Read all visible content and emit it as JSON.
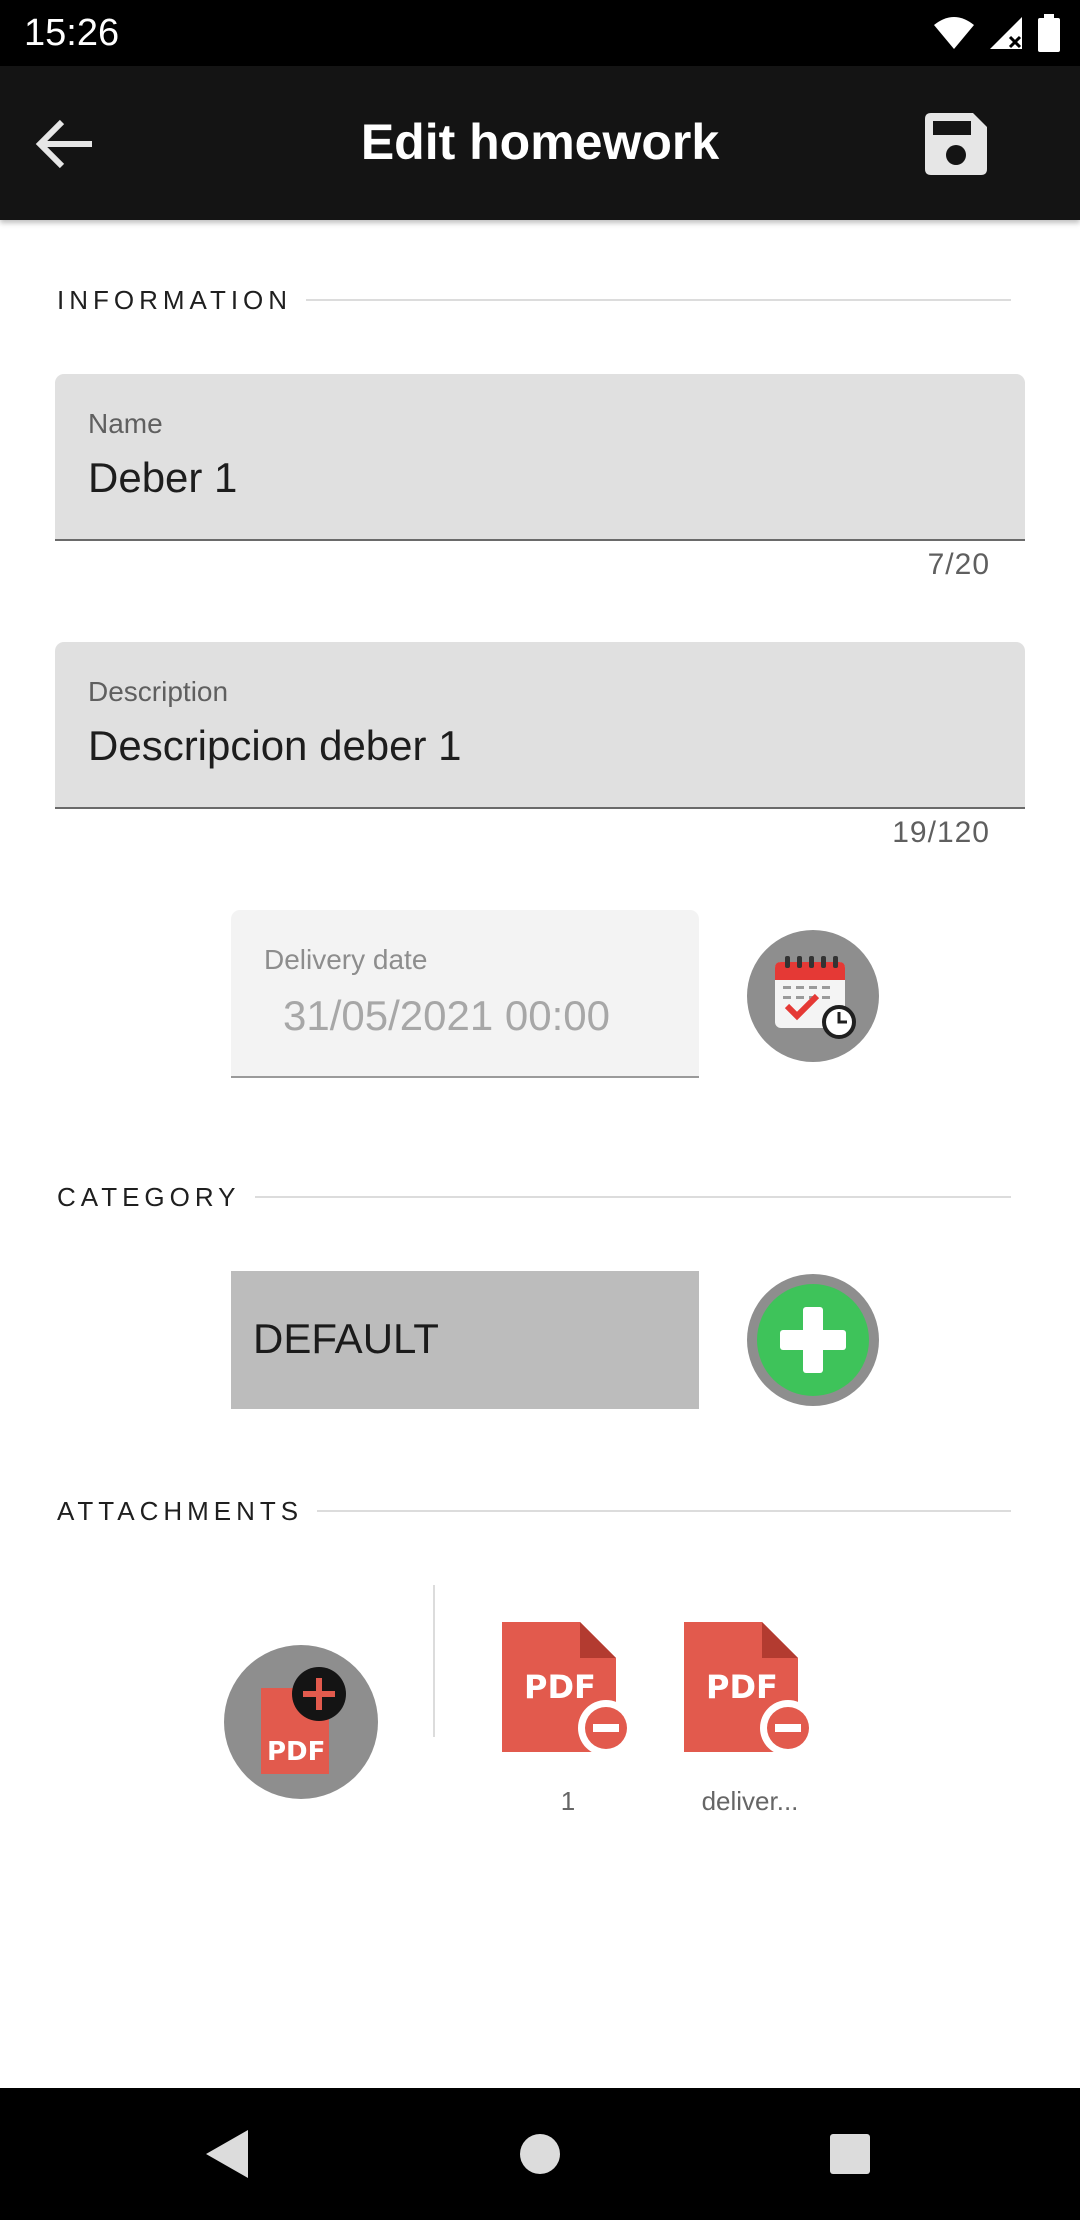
{
  "status_bar": {
    "time": "15:26",
    "icons": [
      "wifi-icon",
      "signal-icon",
      "battery-icon"
    ]
  },
  "app_bar": {
    "title": "Edit homework",
    "back_icon": "arrow-back-icon",
    "save_icon": "floppy-disk-save-icon"
  },
  "sections": {
    "information": "INFORMATION",
    "category": "CATEGORY",
    "attachments": "ATTACHMENTS"
  },
  "name_field": {
    "label": "Name",
    "value": "Deber 1",
    "counter": "7/20"
  },
  "description_field": {
    "label": "Description",
    "value": "Descripcion deber 1",
    "counter": "19/120"
  },
  "delivery_date": {
    "label": "Delivery date",
    "value": "31/05/2021 00:00",
    "picker_icon": "calendar-clock-icon"
  },
  "category": {
    "selected": "DEFAULT",
    "add_icon": "plus-icon"
  },
  "attachments": {
    "add_icon": "add-pdf-icon",
    "items": [
      {
        "label": "1",
        "icon": "pdf-remove-icon"
      },
      {
        "label": "deliver...",
        "icon": "pdf-remove-icon"
      }
    ]
  },
  "nav_bar": {
    "icons": [
      "back-triangle-icon",
      "home-circle-icon",
      "recents-square-icon"
    ]
  },
  "colors": {
    "app_bar": "#141414",
    "field_fill": "#e0e0e0",
    "pdf_red": "#e25a4d",
    "add_green": "#3ec35a",
    "button_grey": "#8e8e8e"
  }
}
